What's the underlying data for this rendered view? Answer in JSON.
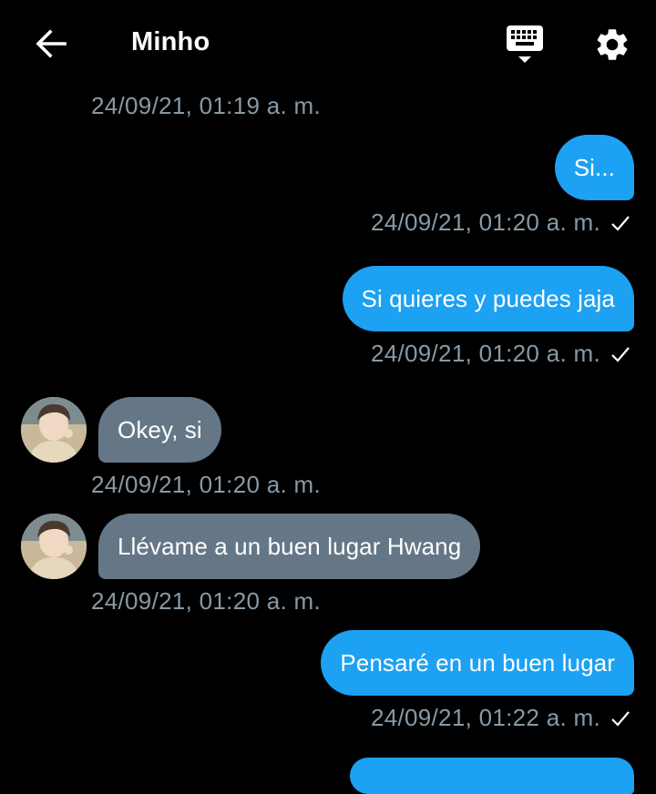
{
  "header": {
    "title": "Minho",
    "back_icon": "arrow-left-icon",
    "keyboard_icon": "keyboard-icon",
    "settings_icon": "gear-icon"
  },
  "colors": {
    "background": "#000000",
    "outgoing_bubble": "#1da1f2",
    "incoming_bubble": "#657786",
    "timestamp": "#8899a6"
  },
  "messages": [
    {
      "direction": "in_timestamp_only",
      "timestamp": "24/09/21, 01:19 a. m."
    },
    {
      "direction": "out",
      "text": "Si...",
      "timestamp": "24/09/21, 01:20 a. m.",
      "status": "sent-check"
    },
    {
      "direction": "out",
      "text": "Si quieres y puedes jaja",
      "timestamp": "24/09/21, 01:20 a. m.",
      "status": "sent-check"
    },
    {
      "direction": "in",
      "text": "Okey, si",
      "timestamp": "24/09/21, 01:20 a. m."
    },
    {
      "direction": "in",
      "text": "Llévame a un buen lugar Hwang",
      "timestamp": "24/09/21, 01:20 a. m."
    },
    {
      "direction": "out",
      "text": "Pensaré en un buen lugar",
      "timestamp": "24/09/21, 01:22 a. m.",
      "status": "sent-check"
    }
  ]
}
